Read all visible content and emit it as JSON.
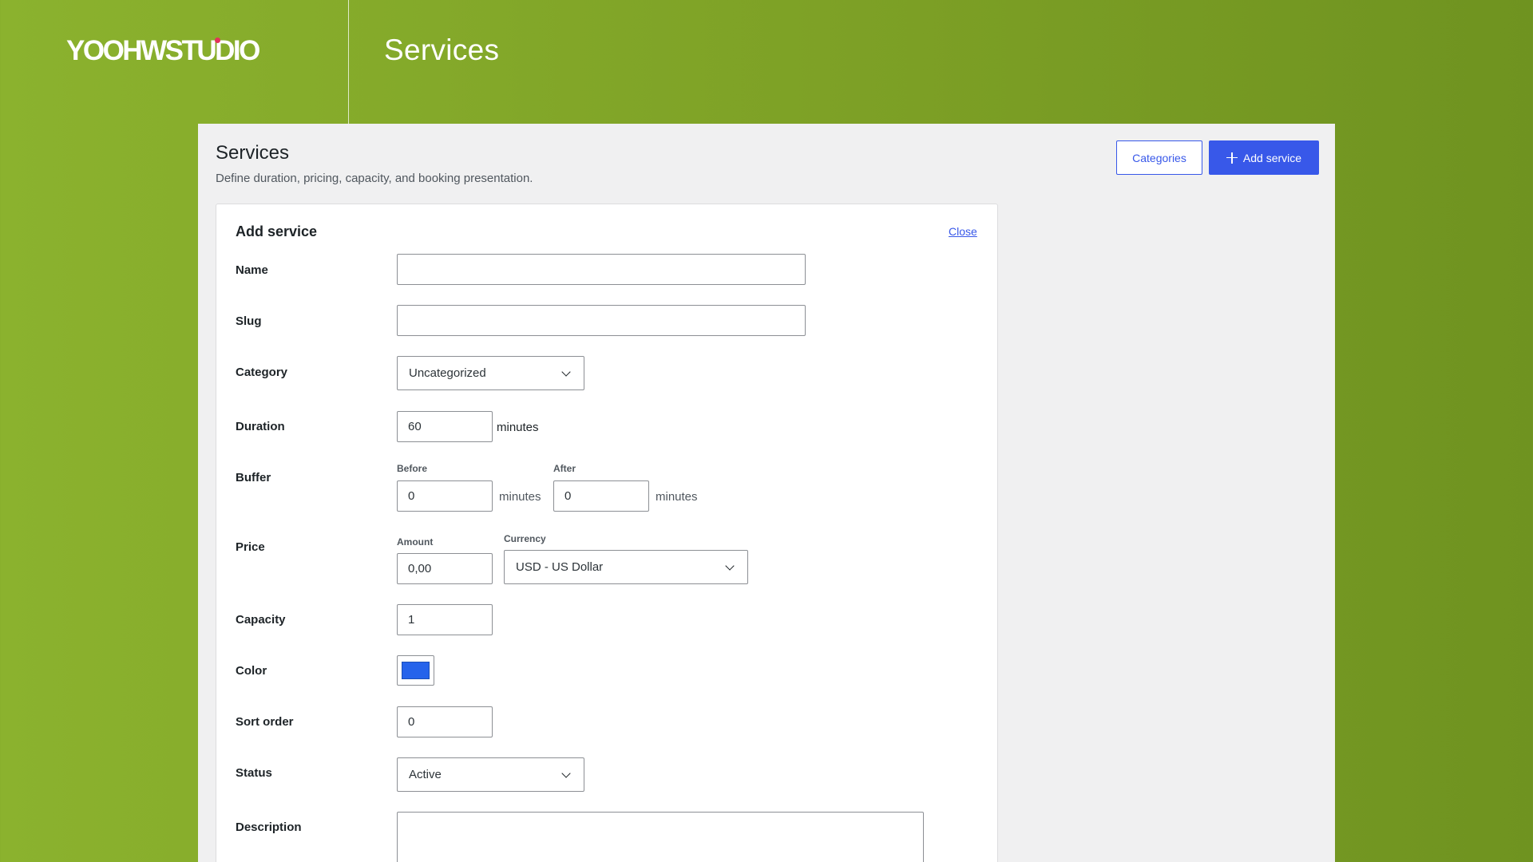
{
  "brand": {
    "logo_text": "YOOHWSTUDIO"
  },
  "header": {
    "title": "Services"
  },
  "page": {
    "title": "Services",
    "description": "Define duration, pricing, capacity, and booking presentation.",
    "categories_button": "Categories",
    "add_service_button": "Add service"
  },
  "form": {
    "title": "Add service",
    "close_link": "Close",
    "name": {
      "label": "Name",
      "value": ""
    },
    "slug": {
      "label": "Slug",
      "value": ""
    },
    "category": {
      "label": "Category",
      "selected": "Uncategorized"
    },
    "duration": {
      "label": "Duration",
      "value": "60",
      "unit": "minutes"
    },
    "buffer": {
      "label": "Buffer",
      "before_label": "Before",
      "before_value": "0",
      "before_unit": "minutes",
      "after_label": "After",
      "after_value": "0",
      "after_unit": "minutes"
    },
    "price": {
      "label": "Price",
      "amount_label": "Amount",
      "amount_value": "0,00",
      "currency_label": "Currency",
      "currency_selected": "USD - US Dollar"
    },
    "capacity": {
      "label": "Capacity",
      "value": "1"
    },
    "color": {
      "label": "Color",
      "value": "#2563eb"
    },
    "sort_order": {
      "label": "Sort order",
      "value": "0"
    },
    "status": {
      "label": "Status",
      "selected": "Active"
    },
    "description": {
      "label": "Description",
      "value": ""
    }
  },
  "colors": {
    "background": "#7fa52a",
    "accent": "#3858e9",
    "panel": "#f0f0f1"
  },
  "icons": {
    "plus": "plus-icon",
    "chevron": "chevron-down-icon"
  }
}
